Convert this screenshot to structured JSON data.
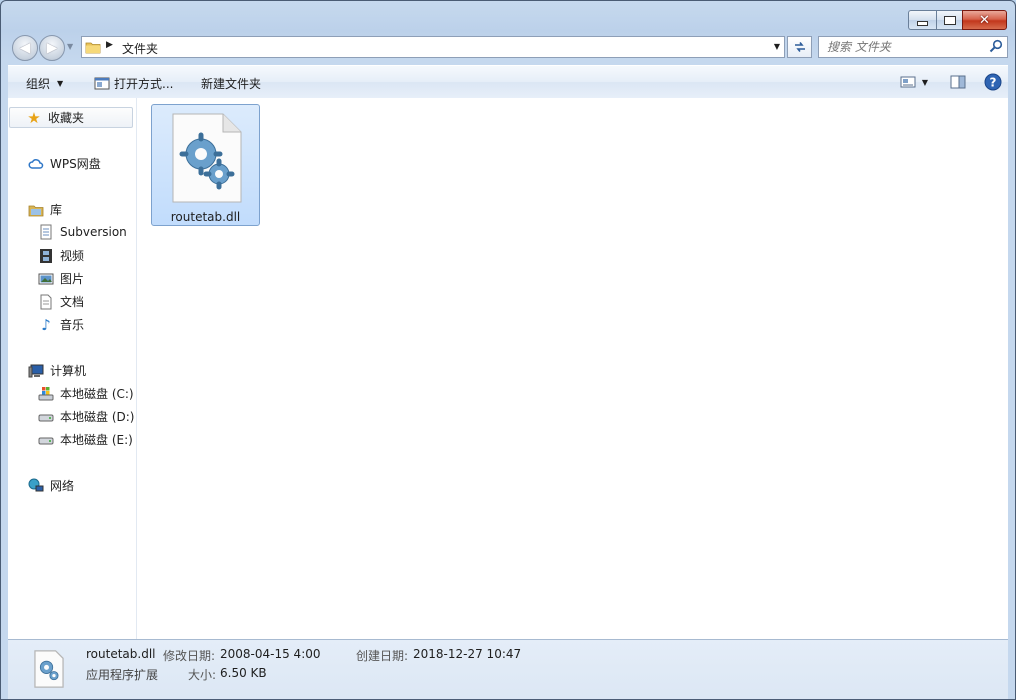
{
  "window": {
    "title": "文件夹",
    "controls": [
      "minimize",
      "maximize",
      "close"
    ]
  },
  "address": {
    "crumb": "文件夹"
  },
  "search": {
    "placeholder": "搜索 文件夹"
  },
  "commands": {
    "organize": "组织",
    "open_with": "打开方式...",
    "new_folder": "新建文件夹"
  },
  "sidebar": {
    "favorites": "收藏夹",
    "wps": "WPS网盘",
    "libraries": "库",
    "library_items": [
      "Subversion",
      "视频",
      "图片",
      "文档",
      "音乐"
    ],
    "computer": "计算机",
    "drives": [
      "本地磁盘 (C:)",
      "本地磁盘 (D:)",
      "本地磁盘 (E:)"
    ],
    "network": "网络"
  },
  "files": [
    {
      "name": "routetab.dll",
      "icon": "dll-gear-file-icon"
    }
  ],
  "details": {
    "filename": "routetab.dll",
    "type": "应用程序扩展",
    "modified_label": "修改日期:",
    "modified_value": "2008-04-15 4:00",
    "size_label": "大小:",
    "size_value": "6.50 KB",
    "created_label": "创建日期:",
    "created_value": "2018-12-27 10:47"
  },
  "colors": {
    "frame": "#bcd1ea",
    "selection": "#cce4fc",
    "close_button": "#c7482c"
  }
}
